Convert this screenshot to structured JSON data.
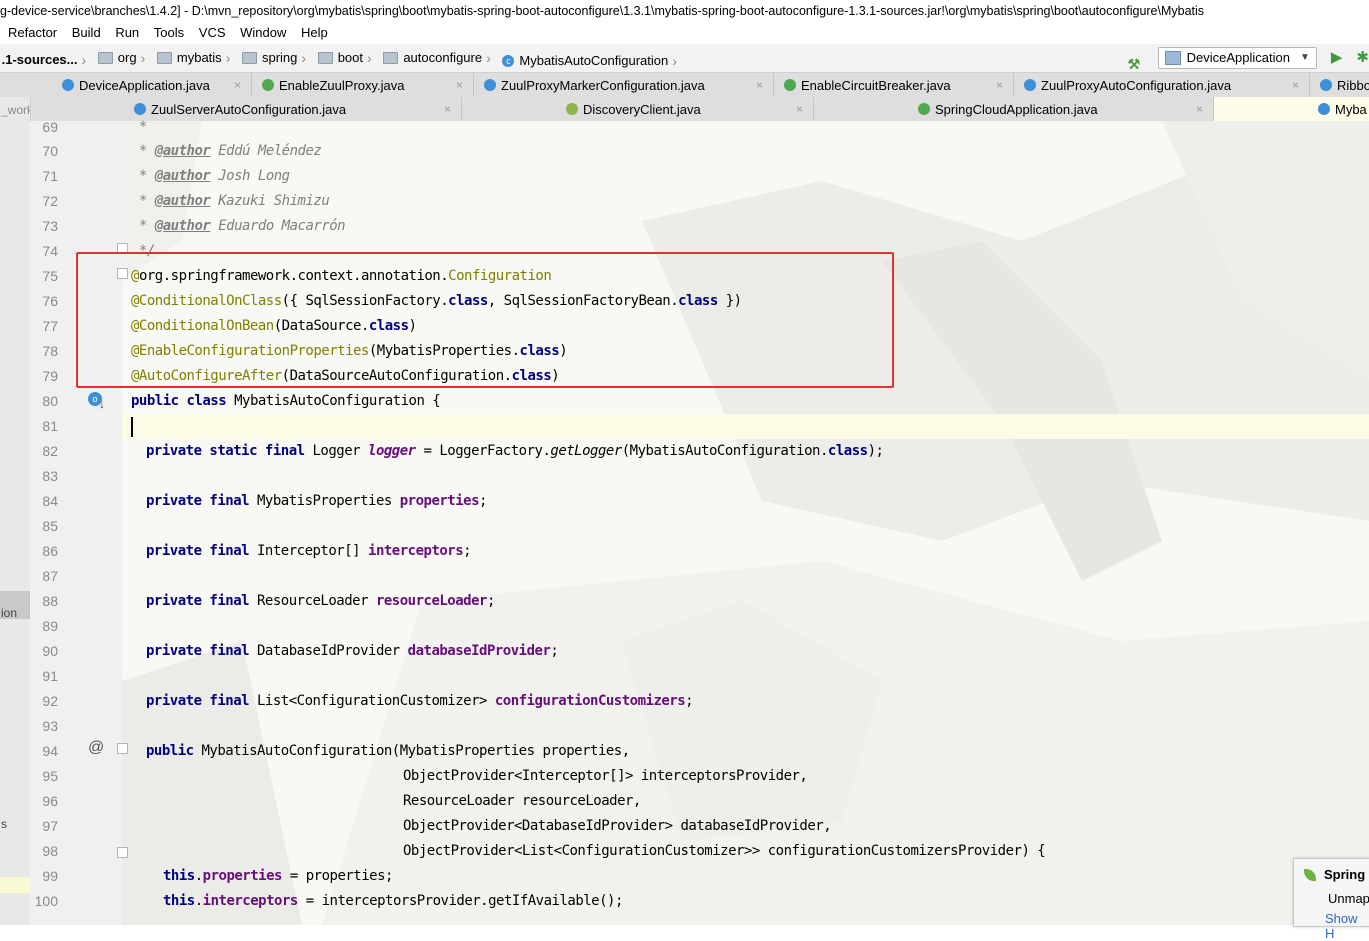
{
  "title_bar": "g-device-service\\branches\\1.4.2] - D:\\mvn_repository\\org\\mybatis\\spring\\boot\\mybatis-spring-boot-autoconfigure\\1.3.1\\mybatis-spring-boot-autoconfigure-1.3.1-sources.jar!\\org\\mybatis\\spring\\boot\\autoconfigure\\Mybatis",
  "menu": [
    "Refactor",
    "Build",
    "Run",
    "Tools",
    "VCS",
    "Window",
    "Help"
  ],
  "breadcrumbs": [
    ".1-sources...",
    "org",
    "mybatis",
    "spring",
    "boot",
    "autoconfigure",
    "MybatisAutoConfiguration"
  ],
  "run_config": "DeviceApplication",
  "tabs_row1": [
    "DeviceApplication.java",
    "EnableZuulProxy.java",
    "ZuulProxyMarkerConfiguration.java",
    "EnableCircuitBreaker.java",
    "ZuulProxyAutoConfiguration.java",
    "Ribbo"
  ],
  "tabs_row2": [
    "ZuulServerAutoConfiguration.java",
    "DiscoveryClient.java",
    "SpringCloudApplication.java",
    "Myba"
  ],
  "left_panel": {
    "top": "_work",
    "mid": "ion",
    "bottom": "s"
  },
  "line_numbers": [
    "69",
    "70",
    "71",
    "72",
    "73",
    "74",
    "75",
    "76",
    "77",
    "78",
    "79",
    "80",
    "81",
    "82",
    "83",
    "84",
    "85",
    "86",
    "87",
    "88",
    "89",
    "90",
    "91",
    "92",
    "93",
    "94",
    "95",
    "96",
    "97",
    "98",
    "99",
    "100"
  ],
  "code": {
    "l69": " *",
    "l70_pre": " * ",
    "l70_tag": "@author",
    "l70_txt": " Eddú Meléndez",
    "l71_pre": " * ",
    "l71_tag": "@author",
    "l71_txt": " Josh Long",
    "l72_pre": " * ",
    "l72_tag": "@author",
    "l72_txt": " Kazuki Shimizu",
    "l73_pre": " * ",
    "l73_tag": "@author",
    "l73_txt": " Eduardo Macarrón",
    "l74": " */",
    "l75_a": "@",
    "l75_b": "org.springframework.context.annotation.",
    "l75_c": "Configuration",
    "l76_a": "@ConditionalOnClass",
    "l76_b": "({ SqlSessionFactory.",
    "l76_c": "class",
    "l76_d": ", SqlSessionFactoryBean.",
    "l76_e": "class",
    "l76_f": " })",
    "l77_a": "@ConditionalOnBean",
    "l77_b": "(DataSource.",
    "l77_c": "class",
    "l77_d": ")",
    "l78_a": "@EnableConfigurationProperties",
    "l78_b": "(MybatisProperties.",
    "l78_c": "class",
    "l78_d": ")",
    "l79_a": "@AutoConfigureAfter",
    "l79_b": "(DataSourceAutoConfiguration.",
    "l79_c": "class",
    "l79_d": ")",
    "l80_a": "public class",
    "l80_b": " MybatisAutoConfiguration {",
    "l82_a": "private static final",
    "l82_b": " Logger ",
    "l82_c": "logger",
    "l82_d": " = LoggerFactory.",
    "l82_e": "getLogger",
    "l82_f": "(MybatisAutoConfiguration.",
    "l82_g": "class",
    "l82_h": ");",
    "l84_a": "private final",
    "l84_b": " MybatisProperties ",
    "l84_c": "properties",
    "l84_d": ";",
    "l86_a": "private final",
    "l86_b": " Interceptor[] ",
    "l86_c": "interceptors",
    "l86_d": ";",
    "l88_a": "private final",
    "l88_b": " ResourceLoader ",
    "l88_c": "resourceLoader",
    "l88_d": ";",
    "l90_a": "private final",
    "l90_b": " DatabaseIdProvider ",
    "l90_c": "databaseIdProvider",
    "l90_d": ";",
    "l92_a": "private final",
    "l92_b": " List<ConfigurationCustomizer> ",
    "l92_c": "configurationCustomizers",
    "l92_d": ";",
    "l94_a": "public",
    "l94_b": " MybatisAutoConfiguration(MybatisProperties properties,",
    "l95": "ObjectProvider<Interceptor[]> interceptorsProvider,",
    "l96": "ResourceLoader resourceLoader,",
    "l97": "ObjectProvider<DatabaseIdProvider> databaseIdProvider,",
    "l98": "ObjectProvider<List<ConfigurationCustomizer>> configurationCustomizersProvider) {",
    "l99_a": "this",
    "l99_b": ".",
    "l99_c": "properties",
    "l99_d": " = properties;",
    "l100_a": "this",
    "l100_b": ".",
    "l100_c": "interceptors",
    "l100_d": " = interceptorsProvider.getIfAvailable();"
  },
  "popup": {
    "title": "Spring",
    "line2": "Unmap",
    "link": "Show H"
  },
  "colors": {
    "highlight_box": "#e53030",
    "keyword": "#000080",
    "annotation": "#808000",
    "field": "#660e7a",
    "comment": "#808080"
  }
}
